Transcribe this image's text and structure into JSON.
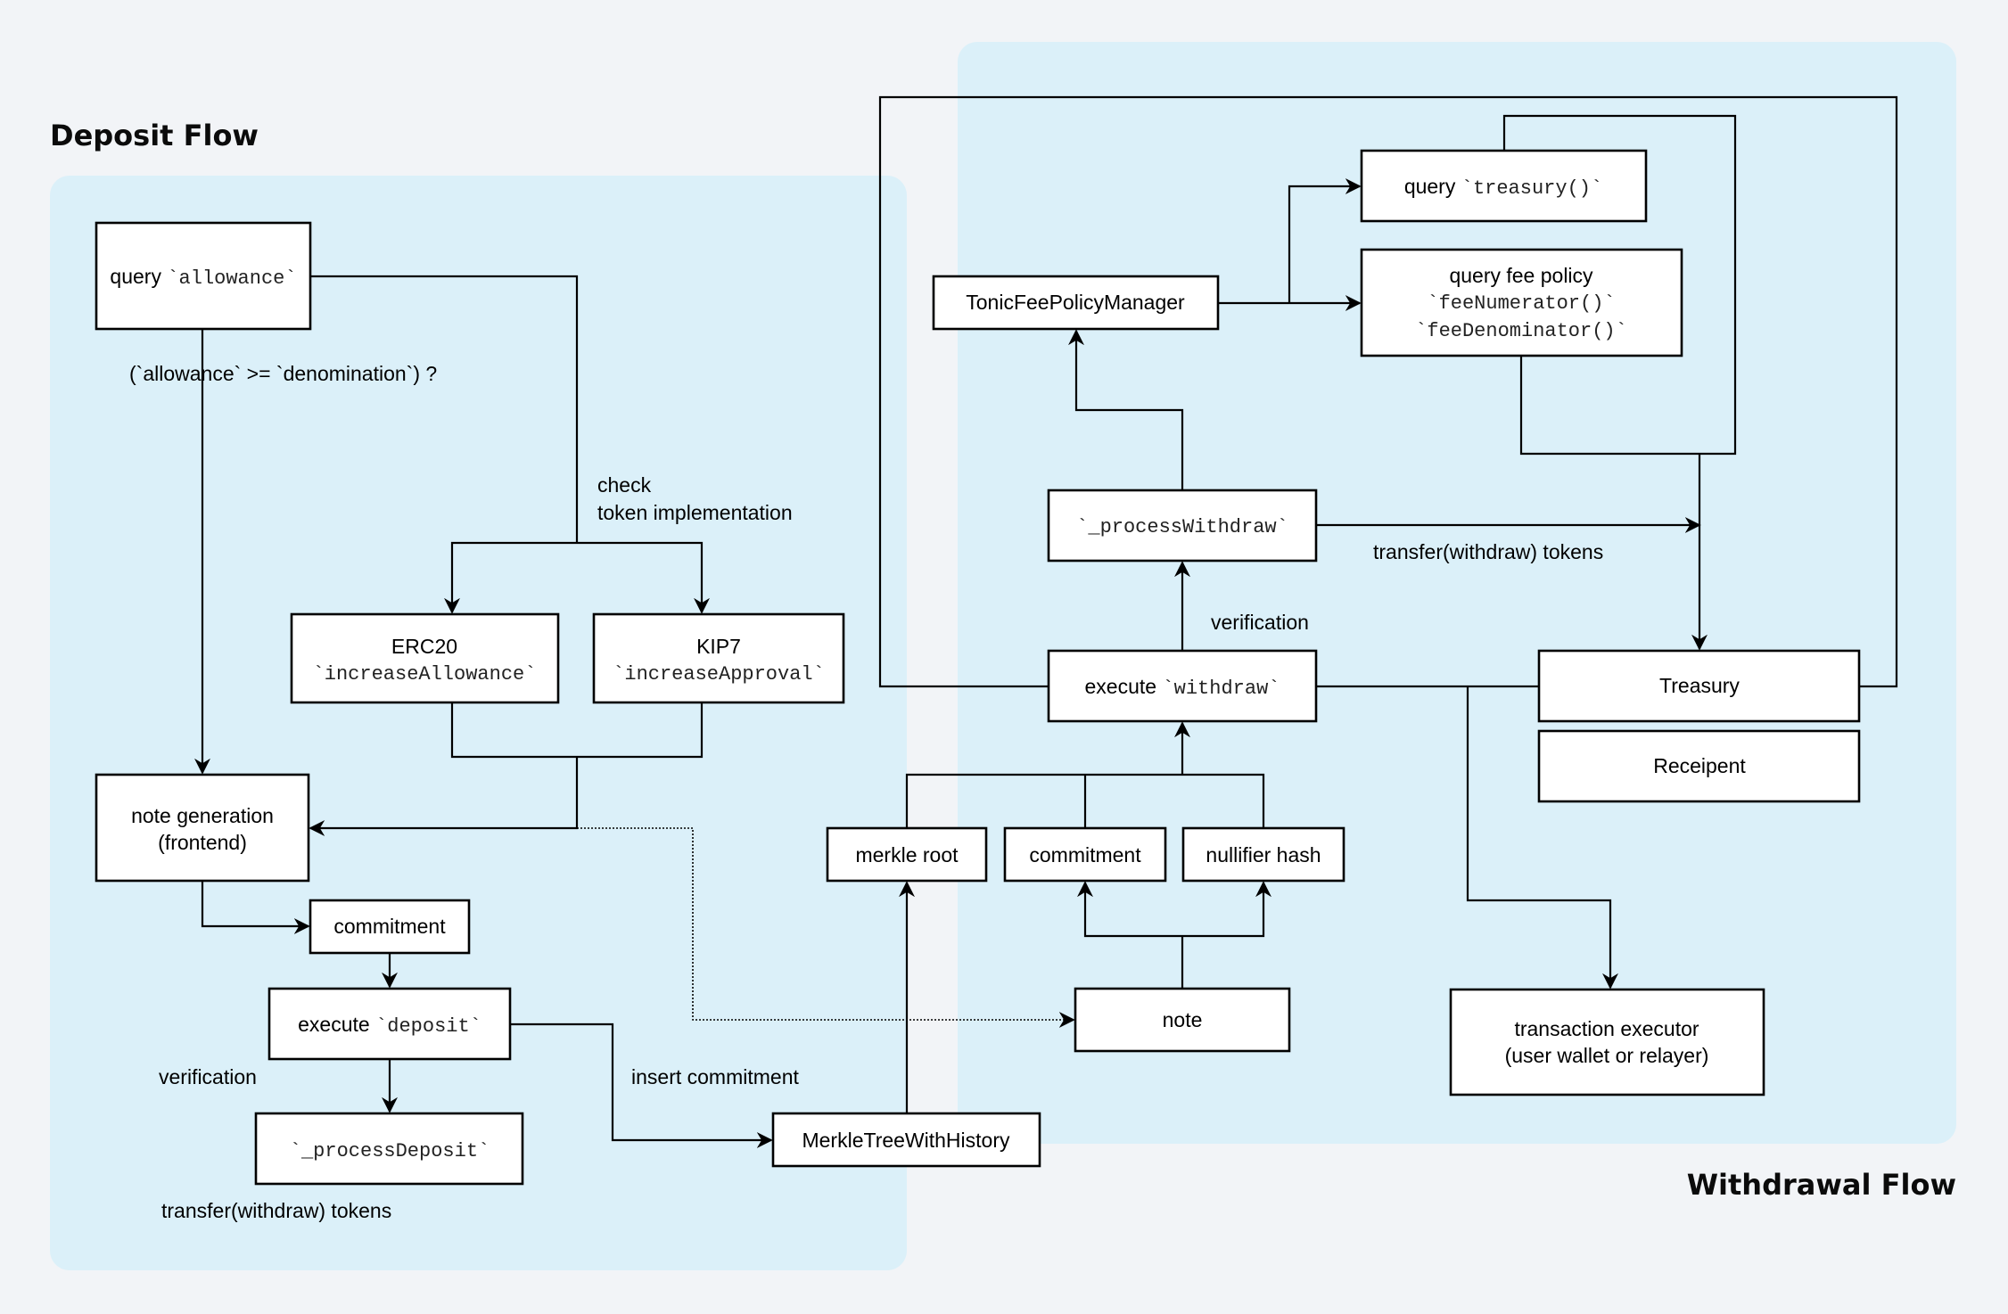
{
  "titles": {
    "deposit": "Deposit Flow",
    "withdrawal": "Withdrawal Flow"
  },
  "colors": {
    "background": "#f2f4f7",
    "panel": "#dbf0f9",
    "box_fill": "#ffffff",
    "stroke": "#000000"
  },
  "deposit": {
    "query_allowance": {
      "text": "query ",
      "code": "`allowance`"
    },
    "condition_label": "(`allowance` >= `denomination`) ?",
    "check_label_1": "check",
    "check_label_2": "token implementation",
    "erc20": {
      "title": "ERC20",
      "code": "`increaseAllowance`"
    },
    "kip7": {
      "title": "KIP7",
      "code": "`increaseApproval`"
    },
    "note_generation_1": "note generation",
    "note_generation_2": "(frontend)",
    "commitment": "commitment",
    "execute_deposit": {
      "text": "execute ",
      "code": "`deposit`"
    },
    "verification_label": "verification",
    "process_deposit": "`_processDeposit`",
    "transfer_label": "transfer(withdraw) tokens",
    "insert_commitment_label": "insert commitment",
    "merkle_tree": "MerkleTreeWithHistory"
  },
  "withdrawal": {
    "merkle_root": "merkle root",
    "commitment": "commitment",
    "nullifier_hash": "nullifier hash",
    "note": "note",
    "execute_withdraw": {
      "text": "execute ",
      "code": "`withdraw`"
    },
    "verification_label": "verification",
    "process_withdraw": "`_processWithdraw`",
    "transfer_label": "transfer(withdraw) tokens",
    "fee_manager": "TonicFeePolicyManager",
    "query_treasury": {
      "text": "query ",
      "code": "`treasury()`"
    },
    "query_fee_policy": {
      "title": "query fee policy",
      "code1": "`feeNumerator()`",
      "code2": "`feeDenominator()`"
    },
    "treasury": "Treasury",
    "recipient": "Receipent",
    "tx_executor_1": "transaction executor",
    "tx_executor_2": "(user wallet or relayer)"
  }
}
